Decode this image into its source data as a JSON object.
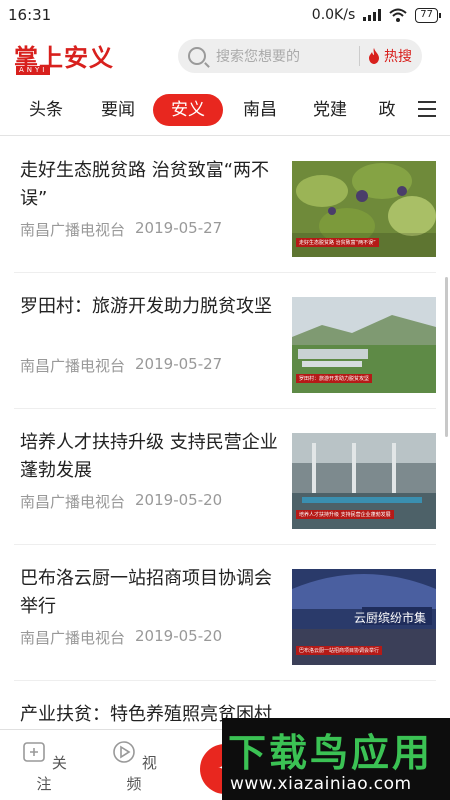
{
  "status_bar": {
    "time": "16:31",
    "net_speed": "0.0K/s",
    "battery": "77"
  },
  "header": {
    "logo_text": "掌上安义",
    "logo_sub": "ANYI",
    "search_placeholder": "搜索您想要的",
    "hot_search_label": "热搜"
  },
  "tabs": [
    {
      "label": "头条"
    },
    {
      "label": "要闻"
    },
    {
      "label": "安义",
      "active": true
    },
    {
      "label": "南昌"
    },
    {
      "label": "党建"
    },
    {
      "label": "政"
    }
  ],
  "news": [
    {
      "title": "走好生态脱贫路 治贫致富“两不误”",
      "source": "南昌广播电视台",
      "date": "2019-05-27",
      "thumb_caption": "走好生态脱贫路 治贫致富“两不误”"
    },
    {
      "title": "罗田村：旅游开发助力脱贫攻坚",
      "source": "南昌广播电视台",
      "date": "2019-05-27",
      "thumb_caption": "罗田村：旅游开发助力脱贫攻坚"
    },
    {
      "title": "培养人才扶持升级  支持民营企业蓬勃发展",
      "source": "南昌广播电视台",
      "date": "2019-05-20",
      "thumb_caption": "培养人才扶持升级 支持民营企业蓬勃发展"
    },
    {
      "title": "巴布洛云厨一站招商项目协调会举行",
      "source": "南昌广播电视台",
      "date": "2019-05-20",
      "thumb_caption": "巴布洛云厨一站招商项目协调会举行",
      "thumb_sign": "云厨缤纷市集"
    },
    {
      "title": "产业扶贫：特色养殖照亮贫困村",
      "source": "",
      "date": ""
    }
  ],
  "bottom_nav": {
    "follow": "关注",
    "video": "视频",
    "center": "expand"
  },
  "watermark": {
    "main": "下载鸟应用",
    "url": "www.xiazainiao.com"
  },
  "colors": {
    "brand_red": "#e8271f",
    "watermark_green": "#3bc254"
  }
}
